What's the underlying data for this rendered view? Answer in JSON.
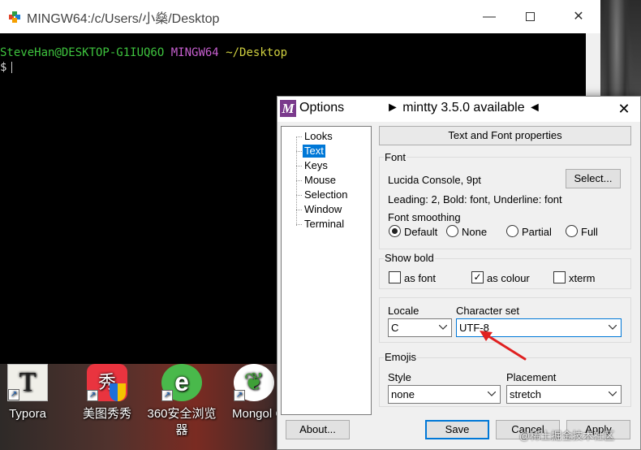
{
  "terminal": {
    "title": "MINGW64:/c/Users/小燊/Desktop",
    "prompt_user": "SteveHan@DESKTOP-G1IUQ6O",
    "prompt_env": "MINGW64",
    "prompt_dir": "~/Desktop",
    "prompt_symbol": "$"
  },
  "dialog": {
    "logo": "M",
    "title": "Options",
    "update_notice": "► mintty 3.5.0 available ◄",
    "close": "✕",
    "tree_items": [
      "Looks",
      "Text",
      "Keys",
      "Mouse",
      "Selection",
      "Window",
      "Terminal"
    ],
    "selected_item": "Text",
    "page_header": "Text and Font properties",
    "font": {
      "group_label": "Font",
      "current_font": "Lucida Console, 9pt",
      "select_button": "Select...",
      "details": "Leading: 2, Bold: font, Underline: font",
      "smoothing_label": "Font smoothing",
      "smoothing_options": [
        "Default",
        "None",
        "Partial",
        "Full"
      ],
      "smoothing_selected": "Default"
    },
    "show_bold": {
      "group_label": "Show bold",
      "options": [
        {
          "label": "as font",
          "checked": false
        },
        {
          "label": "as colour",
          "checked": true
        },
        {
          "label": "xterm",
          "checked": false
        }
      ]
    },
    "locale": {
      "locale_label": "Locale",
      "locale_value": "C",
      "charset_label": "Character set",
      "charset_value": "UTF-8"
    },
    "emojis": {
      "group_label": "Emojis",
      "style_label": "Style",
      "style_value": "none",
      "placement_label": "Placement",
      "placement_value": "stretch"
    },
    "buttons": {
      "about": "About...",
      "save": "Save",
      "cancel": "Cancel",
      "apply": "Apply"
    }
  },
  "desktop_icons": [
    {
      "label": "Typora",
      "glyph": "T"
    },
    {
      "label": "美图秀秀",
      "glyph": "秀"
    },
    {
      "label": "360安全浏览器",
      "glyph": "e"
    },
    {
      "label": "Mongol Compa",
      "glyph": "❦"
    }
  ],
  "watermark": "@稀土掘金技术社区",
  "colors": {
    "selection": "#0078d7",
    "prompt_user": "#3ec33e",
    "prompt_env": "#c65fcf",
    "prompt_dir": "#cfcf3f",
    "annotation_arrow": "#e02020"
  }
}
